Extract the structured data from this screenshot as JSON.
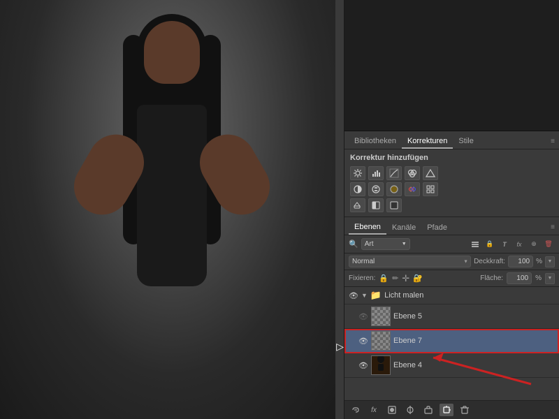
{
  "panel": {
    "tabs1": {
      "items": [
        {
          "label": "Bibliotheken",
          "active": false
        },
        {
          "label": "Korrekturen",
          "active": true
        },
        {
          "label": "Stile",
          "active": false
        }
      ]
    },
    "korrektur": {
      "title": "Korrektur hinzufügen",
      "icons_row1": [
        "☀",
        "📊",
        "☯",
        "🎨",
        "▽"
      ],
      "icons_row2": [
        "⚖",
        "🎭",
        "📷",
        "🔄",
        "▦"
      ],
      "icons_row3": [
        "✏",
        "🔲",
        "⬛"
      ]
    },
    "tabs2": {
      "items": [
        {
          "label": "Ebenen",
          "active": true
        },
        {
          "label": "Kanäle",
          "active": false
        },
        {
          "label": "Pfade",
          "active": false
        }
      ]
    },
    "filter": {
      "label": "Art",
      "icons": [
        "📋",
        "🔒",
        "T",
        "fx",
        "⊕",
        "🗑"
      ]
    },
    "blend_mode": {
      "value": "Normal",
      "opacity_label": "Deckkraft:",
      "opacity_value": "100",
      "opacity_unit": "%"
    },
    "fixieren": {
      "label": "Fixieren:",
      "icons": [
        "🔒",
        "✏",
        "↔",
        "🔐"
      ],
      "flaeche_label": "Fläche:",
      "flaeche_value": "100",
      "flaeche_unit": "%"
    },
    "layers": [
      {
        "type": "group",
        "visible": true,
        "expanded": true,
        "name": "Licht malen",
        "id": "group-licht-malen"
      },
      {
        "type": "layer",
        "visible": false,
        "name": "Ebene 5",
        "thumb": "checker",
        "id": "layer-ebene5",
        "selected": false
      },
      {
        "type": "layer",
        "visible": true,
        "name": "Ebene 7",
        "thumb": "checker",
        "id": "layer-ebene7",
        "selected": true
      },
      {
        "type": "layer",
        "visible": true,
        "name": "Ebene 4",
        "thumb": "photo",
        "id": "layer-ebene4",
        "selected": false
      }
    ],
    "toolbar": {
      "buttons": [
        "fx",
        "⊕",
        "🔄",
        "🗑",
        "📋"
      ]
    }
  }
}
